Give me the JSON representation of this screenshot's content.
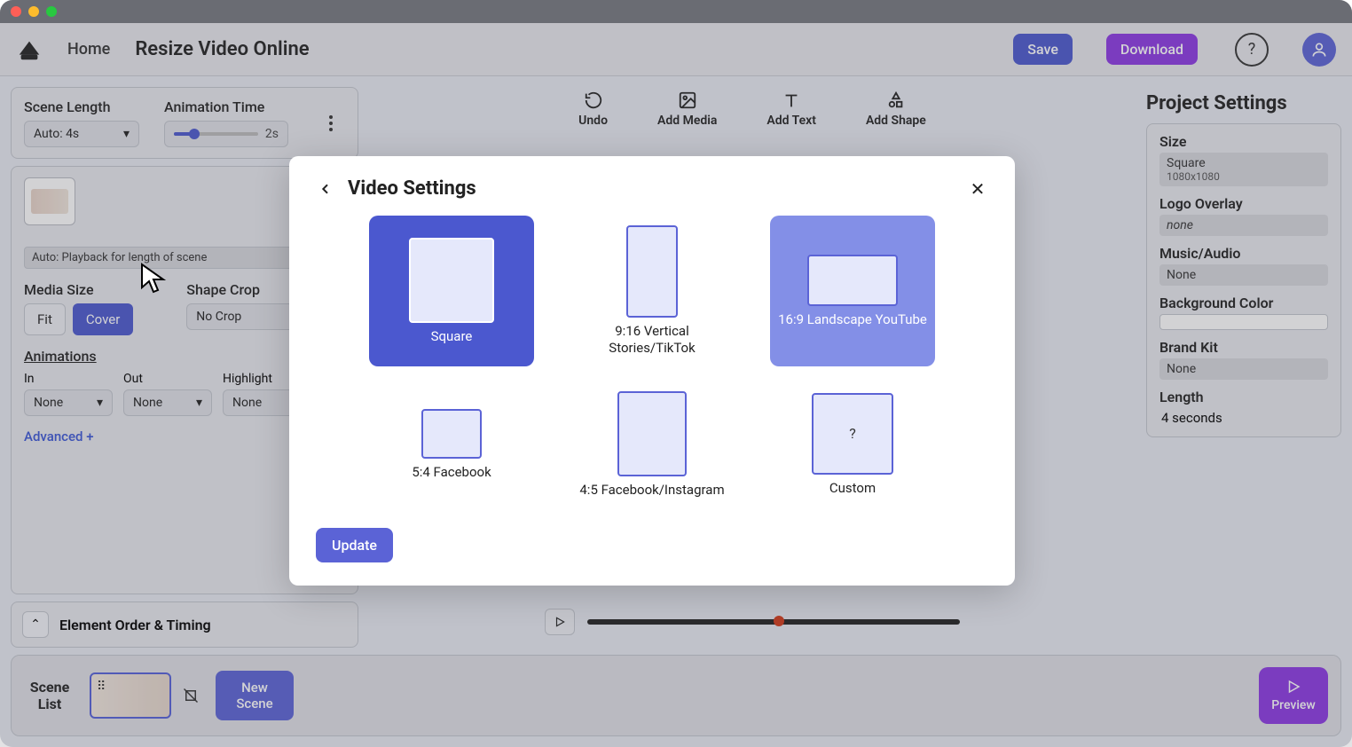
{
  "topbar": {
    "home": "Home",
    "title": "Resize Video Online",
    "save": "Save",
    "download": "Download"
  },
  "scene_panel": {
    "scene_length_label": "Scene Length",
    "scene_length_value": "Auto: 4s",
    "animation_time_label": "Animation Time",
    "animation_time_value": "2s",
    "playback_tip": "Auto: Playback for length of scene",
    "media_size_label": "Media Size",
    "media_size_fit": "Fit",
    "media_size_cover": "Cover",
    "shape_crop_label": "Shape Crop",
    "shape_crop_value": "No Crop",
    "animations_label": "Animations",
    "anim_in_label": "In",
    "anim_in_value": "None",
    "anim_out_label": "Out",
    "anim_out_value": "None",
    "anim_highlight_label": "Highlight",
    "anim_highlight_value": "None",
    "advanced": "Advanced +",
    "element_order": "Element Order & Timing"
  },
  "tools": {
    "undo": "Undo",
    "add_media": "Add Media",
    "add_text": "Add Text",
    "add_shape": "Add Shape"
  },
  "right_panel": {
    "title": "Project Settings",
    "size_label": "Size",
    "size_value": "Square",
    "size_sub": "1080x1080",
    "logo_label": "Logo Overlay",
    "logo_value": "none",
    "music_label": "Music/Audio",
    "music_value": "None",
    "bg_label": "Background Color",
    "brand_label": "Brand Kit",
    "brand_value": "None",
    "length_label": "Length",
    "length_value": "4 seconds"
  },
  "bottombar": {
    "scene_list": "Scene List",
    "new_scene": "New Scene",
    "preview": "Preview"
  },
  "modal": {
    "title": "Video Settings",
    "update": "Update",
    "options": {
      "square": "Square",
      "vertical": "9:16 Vertical Stories/TikTok",
      "landscape": "16:9 Landscape YouTube",
      "fb54": "5:4 Facebook",
      "fb45": "4:5 Facebook/Instagram",
      "custom": "Custom",
      "custom_mark": "?"
    }
  }
}
